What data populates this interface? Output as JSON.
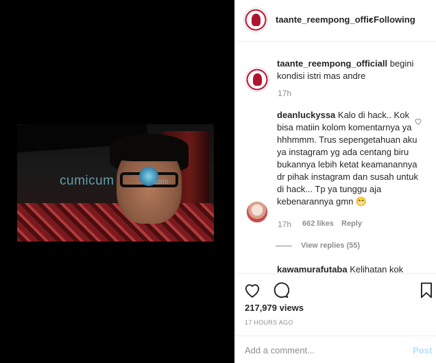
{
  "header": {
    "username": "taante_reempong_offic",
    "separator": "•",
    "follow_state": "Following"
  },
  "caption": {
    "username": "taante_reempong_officiall",
    "text": " begini kondisi istri mas andre",
    "time": "17h"
  },
  "comment": {
    "username": "deanluckyssa",
    "text": " Kalo di hack.. Kok bisa matiin kolom komentarnya ya hhhmmm. Trus sepengetahuan aku ya instagram yg ada centang biru bukannya lebih ketat keamanannya dr pihak instagram dan susah untuk di hack... Tp ya tunggu aja kebenarannya gmn 😁",
    "time": "17h",
    "likes": "662 likes",
    "reply_label": "Reply",
    "view_replies": "View replies (55)"
  },
  "next_comment": {
    "username": "kawamurafutaba",
    "text": " Kelihatan kok",
    "more": "..."
  },
  "media": {
    "watermark": "cumicum",
    "watermark_suffix": ".com"
  },
  "stats": {
    "views": "217,979 views",
    "time_ago": "17 HOURS AGO"
  },
  "add_comment": {
    "placeholder": "Add a comment...",
    "post_label": "Post"
  },
  "icons": [
    "heart-icon",
    "comment-icon",
    "bookmark-icon",
    "small-heart-icon"
  ],
  "colors": {
    "post_disabled": "#b2dffc",
    "meta": "#8e8e8e",
    "border": "#efefef"
  }
}
